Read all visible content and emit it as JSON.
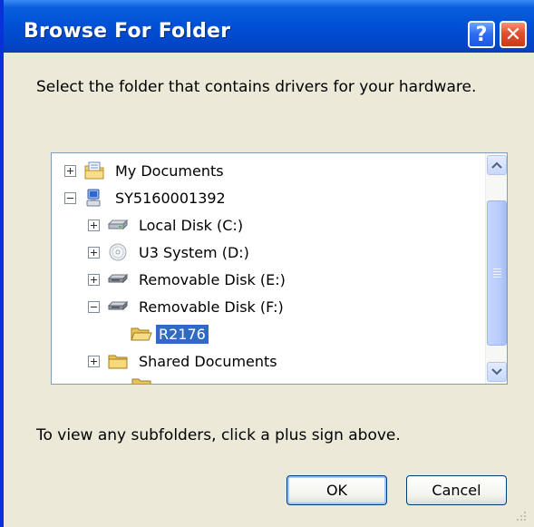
{
  "window": {
    "title": "Browse For Folder",
    "help_glyph": "?",
    "close_glyph": "✕",
    "accent_color": "#0051d6"
  },
  "prompt": "Select the folder that contains drivers for your hardware.",
  "tree": {
    "items": [
      {
        "label": "My Documents",
        "expander": "plus",
        "icon": "documents-folder-icon"
      },
      {
        "label": "SY5160001392",
        "expander": "minus",
        "icon": "computer-icon"
      },
      {
        "label": "Local Disk (C:)",
        "expander": "plus",
        "icon": "hard-disk-icon"
      },
      {
        "label": "U3 System (D:)",
        "expander": "plus",
        "icon": "cd-drive-icon"
      },
      {
        "label": "Removable Disk (E:)",
        "expander": "plus",
        "icon": "removable-disk-icon"
      },
      {
        "label": "Removable Disk (F:)",
        "expander": "minus",
        "icon": "removable-disk-icon"
      },
      {
        "label": "R2176",
        "expander": "none",
        "icon": "open-folder-icon",
        "selected": true
      },
      {
        "label": "Shared Documents",
        "expander": "plus",
        "icon": "folder-icon"
      }
    ]
  },
  "hint": "To view any subfolders, click a plus sign above.",
  "buttons": {
    "ok": "OK",
    "cancel": "Cancel"
  }
}
